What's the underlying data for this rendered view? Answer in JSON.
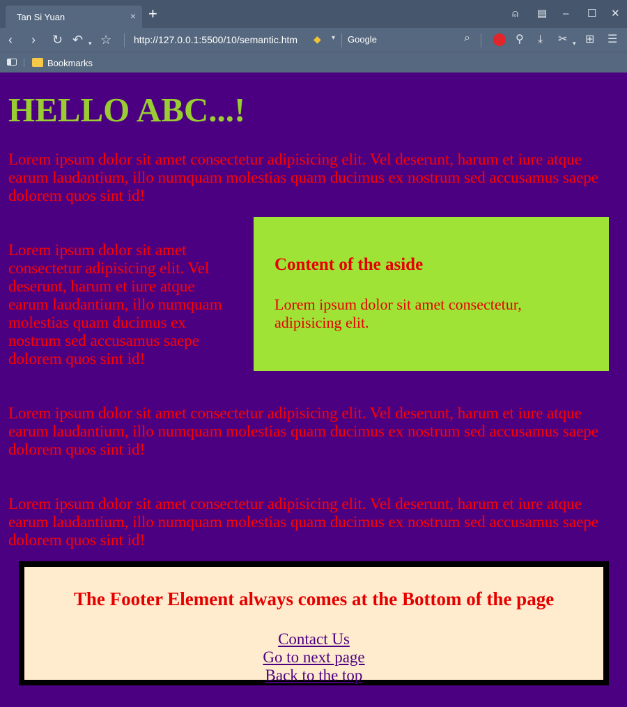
{
  "browser": {
    "tab_title": "Tan Si Yuan",
    "tab_close": "×",
    "new_tab": "+",
    "url": "http://127.0.0.1:5500/10/semantic.htm",
    "search_engine": "Google",
    "bookmarks_label": "Bookmarks"
  },
  "page": {
    "heading": "HELLO ABC...!",
    "paragraphs": [
      "Lorem ipsum dolor sit amet consectetur adipisicing elit. Vel deserunt, harum et iure atque earum laudantium, illo numquam molestias quam ducimus ex nostrum sed accusamus saepe dolorem quos sint id!",
      "Lorem ipsum dolor sit amet consectetur adipisicing elit. Vel deserunt, harum et iure atque earum laudantium, illo numquam molestias quam ducimus ex nostrum sed accusamus saepe dolorem quos sint id!",
      "Lorem ipsum dolor sit amet consectetur adipisicing elit. Vel deserunt, harum et iure atque earum laudantium, illo numquam molestias quam ducimus ex nostrum sed accusamus saepe dolorem quos sint id!",
      "Lorem ipsum dolor sit amet consectetur adipisicing elit. Vel deserunt, harum et iure atque earum laudantium, illo numquam molestias quam ducimus ex nostrum sed accusamus saepe dolorem quos sint id!"
    ],
    "aside": {
      "title": "Content of the aside",
      "text": "Lorem ipsum dolor sit amet consectetur, adipisicing elit."
    },
    "footer": {
      "title": "The Footer Element always comes at the Bottom of the page",
      "links": [
        "Contact Us",
        "Go to next page",
        "Back to the top"
      ]
    }
  },
  "colors": {
    "page_background": "#4b0082",
    "heading": "#9acd32",
    "text": "#ff0000",
    "aside_background": "#9fe336",
    "footer_background": "#ffebcd",
    "footer_border": "#000000"
  }
}
